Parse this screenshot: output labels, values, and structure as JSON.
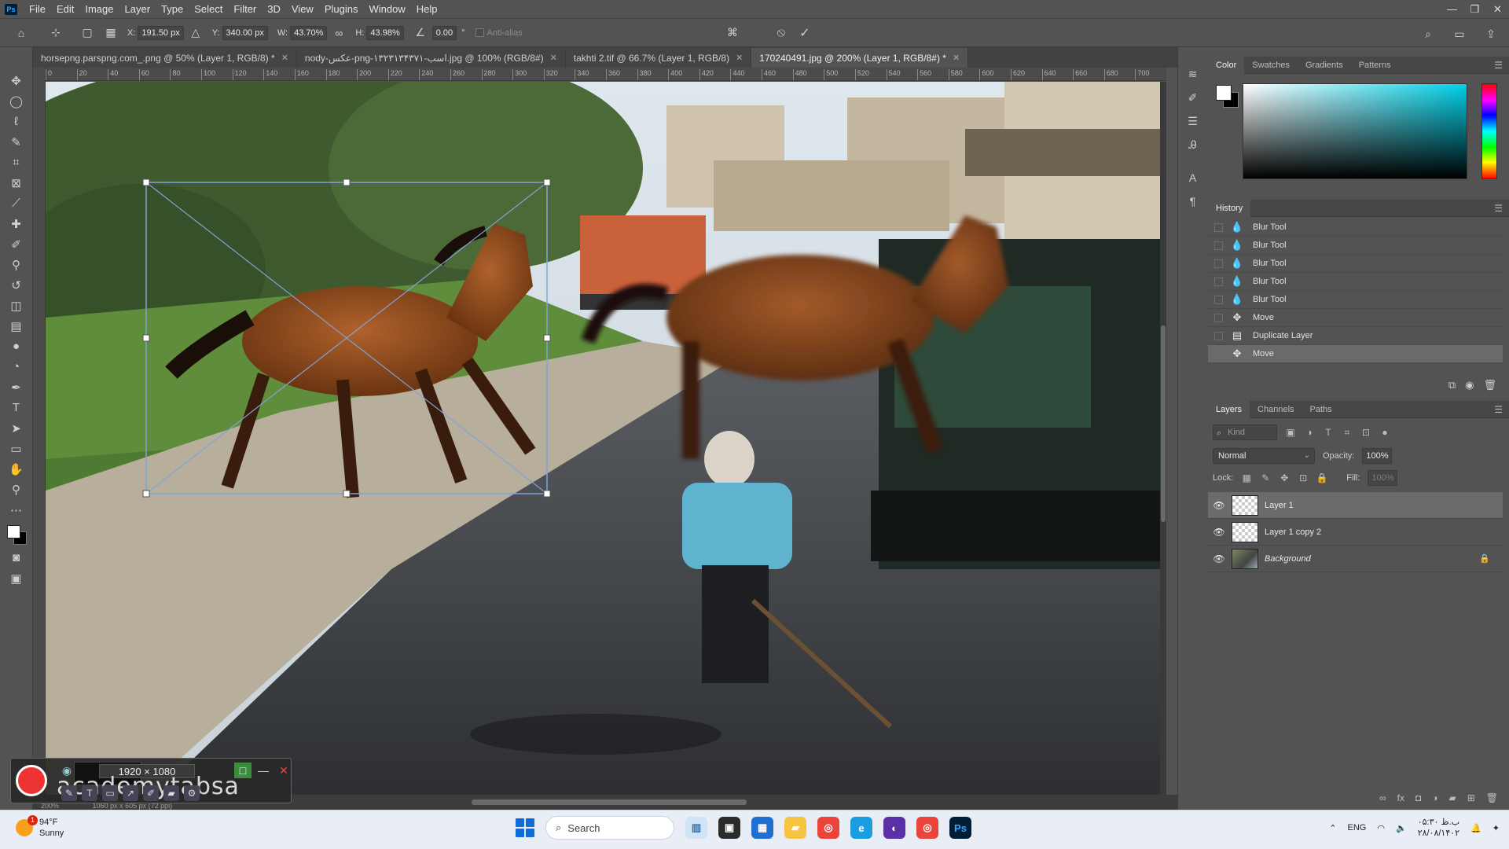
{
  "app": {
    "logo": "Ps"
  },
  "menu": [
    "File",
    "Edit",
    "Image",
    "Layer",
    "Type",
    "Select",
    "Filter",
    "3D",
    "View",
    "Plugins",
    "Window",
    "Help"
  ],
  "window_controls": {
    "minimize": "—",
    "restore": "❐",
    "close": "✕"
  },
  "options": {
    "x_label": "X:",
    "x_value": "191.50 px",
    "y_label": "Y:",
    "y_value": "340.00 px",
    "w_label": "W:",
    "w_value": "43.70%",
    "h_label": "H:",
    "h_value": "43.98%",
    "angle_value": "0.00",
    "angle_unit": "°",
    "antialias_label": "Anti-alias"
  },
  "tabs": [
    {
      "label": "horsepng.parspng.com_.png @ 50% (Layer 1, RGB/8) *"
    },
    {
      "label": "nody-عکس-png-اسب-۱۳۲۳۱۳۴۳۷۱.jpg @ 100% (RGB/8#)"
    },
    {
      "label": "takhti 2.tif @ 66.7% (Layer 1, RGB/8)"
    },
    {
      "label": "170240491.jpg @ 200% (Layer 1, RGB/8#) *"
    }
  ],
  "ruler_ticks": [
    "0",
    "20",
    "40",
    "60",
    "80",
    "100",
    "120",
    "140",
    "160",
    "180",
    "200",
    "220",
    "240",
    "260",
    "280",
    "300",
    "320",
    "340",
    "360",
    "380",
    "400",
    "420",
    "440",
    "460",
    "480",
    "500",
    "520",
    "540",
    "560",
    "580",
    "600",
    "620",
    "640",
    "660",
    "680",
    "700"
  ],
  "status": {
    "zoom": "200%",
    "doc": "1060 px x 605 px (72 ppi)"
  },
  "capture_tool": {
    "dims": "1920 × 1080",
    "watermark": "academytabsa"
  },
  "color_panel": {
    "tabs": [
      "Color",
      "Swatches",
      "Gradients",
      "Patterns"
    ]
  },
  "history_panel": {
    "title": "History",
    "items": [
      {
        "label": "Blur Tool",
        "icon": "drop-icon"
      },
      {
        "label": "Blur Tool",
        "icon": "drop-icon"
      },
      {
        "label": "Blur Tool",
        "icon": "drop-icon"
      },
      {
        "label": "Blur Tool",
        "icon": "drop-icon"
      },
      {
        "label": "Blur Tool",
        "icon": "drop-icon"
      },
      {
        "label": "Move",
        "icon": "move-icon"
      },
      {
        "label": "Duplicate Layer",
        "icon": "layer-icon"
      },
      {
        "label": "Move",
        "icon": "move-icon"
      }
    ]
  },
  "layers_panel": {
    "tabs": [
      "Layers",
      "Channels",
      "Paths"
    ],
    "kind_placeholder": "Kind",
    "blend_mode": "Normal",
    "opacity_label": "Opacity:",
    "opacity_value": "100%",
    "lock_label": "Lock:",
    "fill_label": "Fill:",
    "fill_value": "100%",
    "layers": [
      {
        "name": "Layer 1"
      },
      {
        "name": "Layer 1 copy 2"
      },
      {
        "name": "Background"
      }
    ]
  },
  "taskbar": {
    "temperature": "94°F",
    "condition": "Sunny",
    "weather_badge": "1",
    "search_placeholder": "Search",
    "language": "ENG",
    "time": "۰۵:۳۰ ب.ظ",
    "date": "۲۸/۰۸/۱۴۰۲"
  },
  "colors": {
    "ps_accent": "#31a8ff",
    "panel_bg": "#535353",
    "taskbar_bg": "#e9eef6"
  }
}
